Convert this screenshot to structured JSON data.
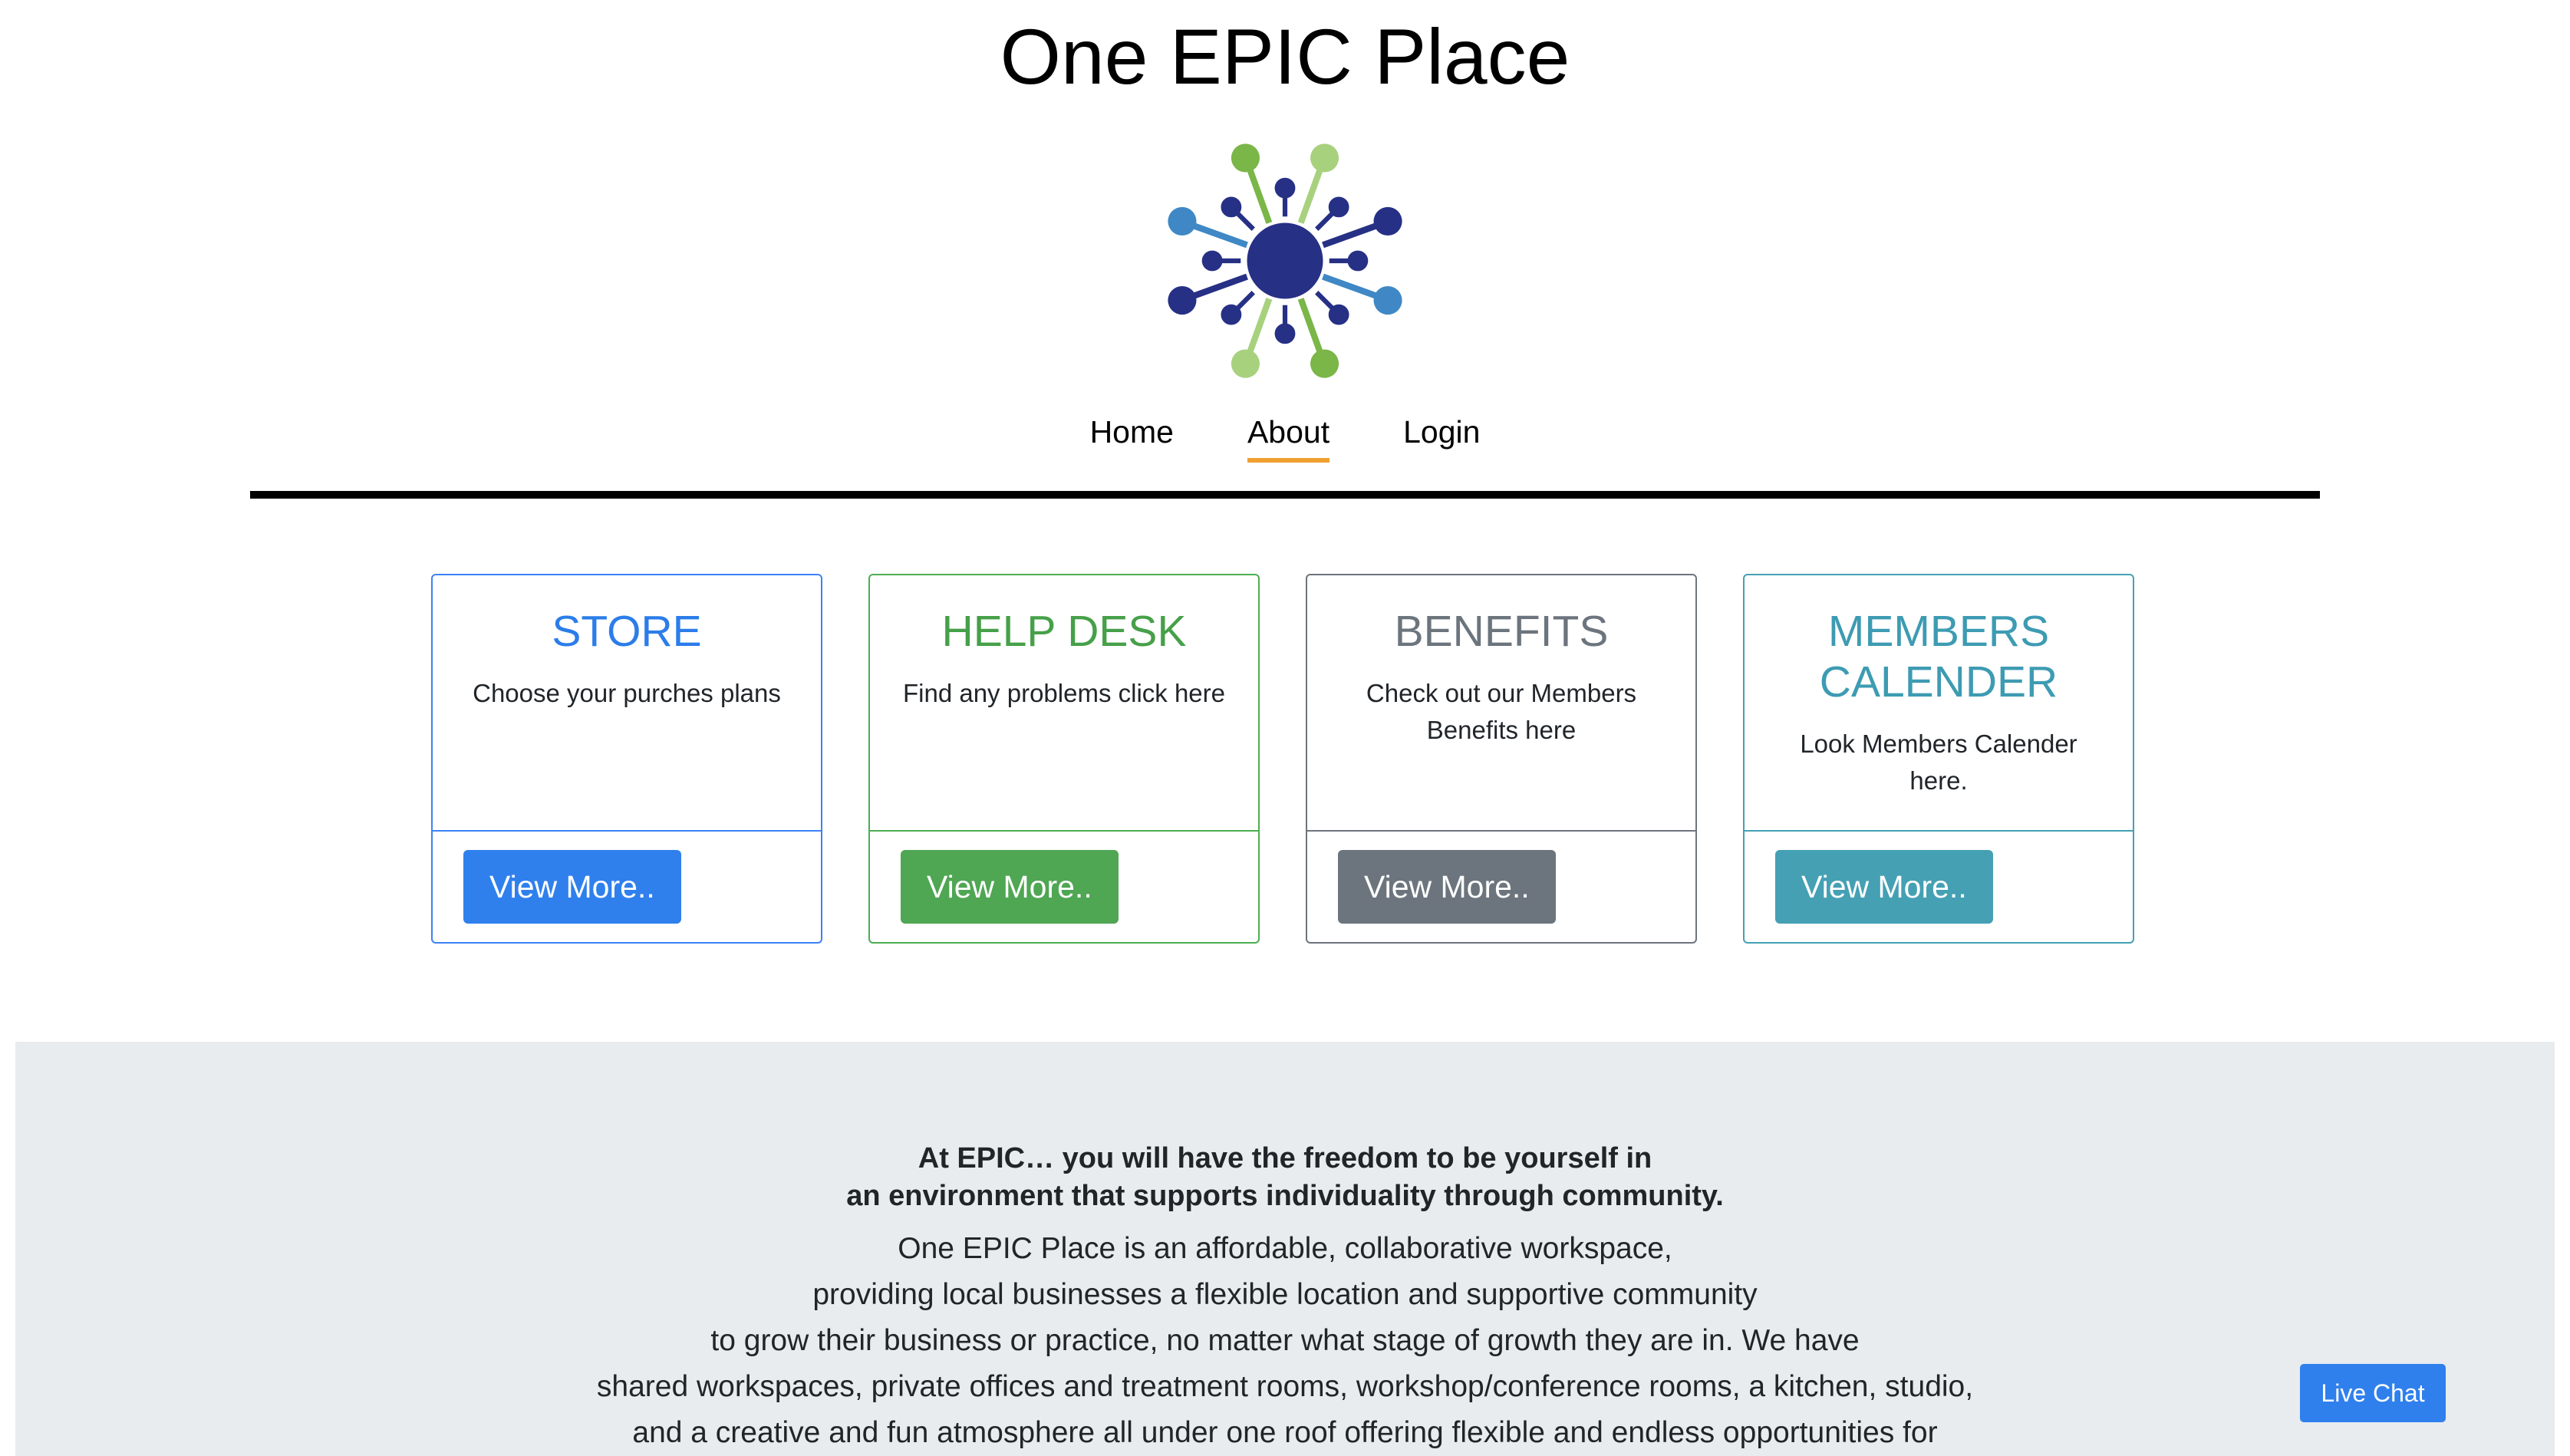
{
  "site": {
    "title": "One EPIC Place",
    "logo_icon": "epic-network-logo-icon"
  },
  "nav": {
    "items": [
      {
        "label": "Home",
        "active": false
      },
      {
        "label": "About",
        "active": true
      },
      {
        "label": "Login",
        "active": false
      }
    ]
  },
  "cards": [
    {
      "title": "STORE",
      "text": "Choose your purches plans",
      "button": "View More..",
      "color": "#2f80ed"
    },
    {
      "title": "HELP DESK",
      "text": "Find any problems click here",
      "button": "View More..",
      "color": "#4fa653"
    },
    {
      "title": "BENEFITS",
      "text_line1": "Check out our Members",
      "text_line2": "Benefits here",
      "button": "View More..",
      "color": "#6c757d"
    },
    {
      "title_line1": "MEMBERS",
      "title_line2": "CALENDER",
      "text_line1": "Look Members Calender",
      "text_line2": "here.",
      "button": "View More..",
      "color": "#45a0b4"
    }
  ],
  "about": {
    "headline_line1": "At EPIC… you will have the freedom to be yourself in",
    "headline_line2": "an environment that supports individuality through community.",
    "lines": [
      "One EPIC Place is an affordable, collaborative workspace,",
      "providing local businesses a flexible location and supportive community",
      "to grow their business or practice, no matter what stage of growth they are in. We have",
      "shared workspaces, private offices and treatment rooms, workshop/conference rooms, a kitchen, studio,",
      "and a creative and fun atmosphere all under one roof offering flexible and endless opportunities for"
    ]
  },
  "chat": {
    "label": "Live Chat"
  }
}
